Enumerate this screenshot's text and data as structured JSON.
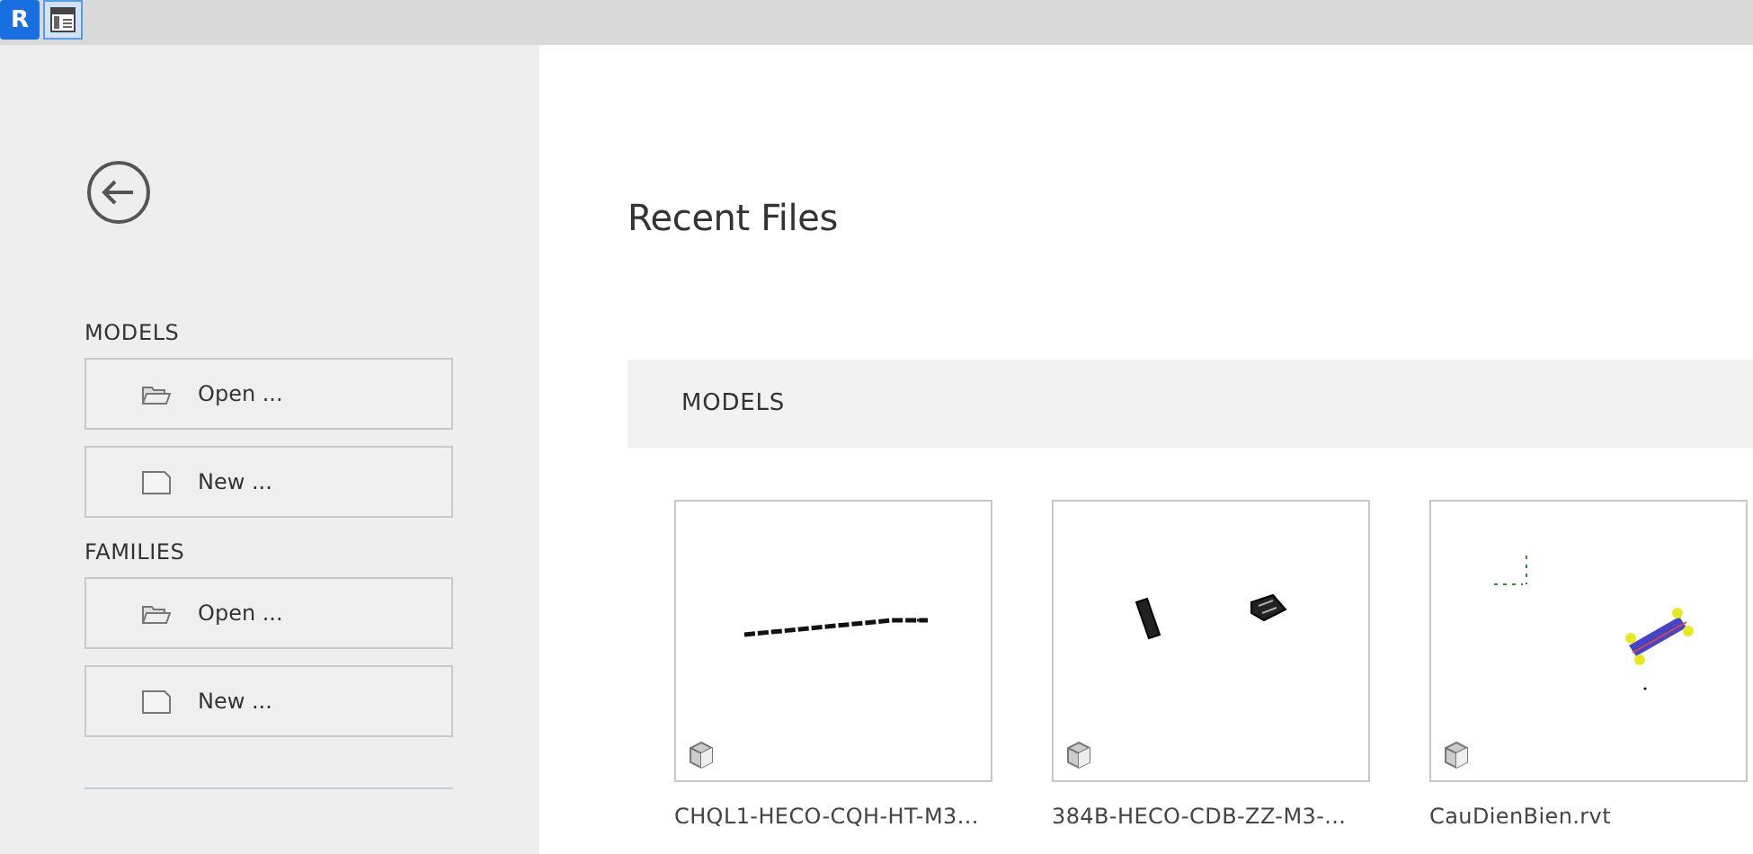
{
  "top_bar": {
    "logo": "R"
  },
  "sidebar": {
    "sections": [
      {
        "title": "MODELS",
        "buttons": [
          {
            "kind": "open",
            "label": "Open ..."
          },
          {
            "kind": "new",
            "label": "New ..."
          }
        ]
      },
      {
        "title": "FAMILIES",
        "buttons": [
          {
            "kind": "open",
            "label": "Open ..."
          },
          {
            "kind": "new",
            "label": "New ..."
          }
        ]
      }
    ]
  },
  "main": {
    "title": "Recent Files",
    "section": "MODELS",
    "files": [
      {
        "name": "CHQL1-HECO-CQH-HT-M3..."
      },
      {
        "name": "384B-HECO-CDB-ZZ-M3-..."
      },
      {
        "name": "CauDienBien.rvt"
      }
    ]
  }
}
